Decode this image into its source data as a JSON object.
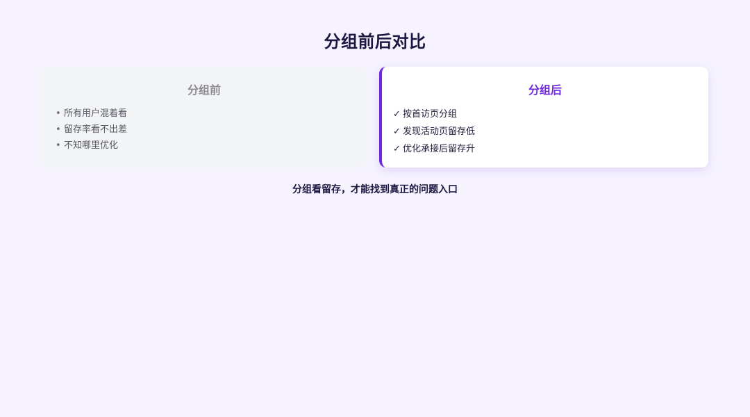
{
  "page": {
    "title": "分组前后对比",
    "footer_text": "分组看留存，才能找到真正的问题入口"
  },
  "before": {
    "title": "分组前",
    "bullet": "•",
    "items": [
      "所有用户混着看",
      "留存率看不出差",
      "不知哪里优化"
    ]
  },
  "after": {
    "title": "分组后",
    "bullet": "✓",
    "items": [
      "按首访页分组",
      "发现活动页留存低",
      "优化承接后留存升"
    ]
  },
  "colors": {
    "background": "#f6f3ff",
    "accent": "#6d28d9",
    "before_card": "#f3f4f6",
    "after_card": "#ffffff"
  }
}
